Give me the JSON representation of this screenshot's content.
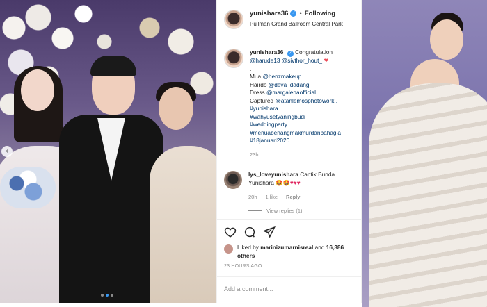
{
  "post": {
    "username": "yunishara36",
    "follow_status": "Following",
    "location": "Pullman Grand Ballroom Central Park"
  },
  "caption": {
    "username": "yunishara36",
    "line1": "Congratulation",
    "mentions1": "@harude13 @sivthor_hout_",
    "dot": ".",
    "mua_label": "Mua",
    "mua_handle": "@henzmakeup",
    "hairdo_label": "Hairdo",
    "hairdo_handle": "@deva_dadang",
    "dress_label": "Dress",
    "dress_handle": "@margalenaofficial",
    "captured_label": "Captured",
    "captured_handle": "@atanlemosphotowork .",
    "tag1": "#yunishara",
    "tag2": "#wahyusetyaningbudi",
    "tag3": "#weddingparty",
    "tag4": "#menuabenangmakmurdanbahagia",
    "tag5": "#18januari2020",
    "time": "23h"
  },
  "comment": {
    "username": "lys_loveyunishara",
    "text": "Cantik Bunda Yunishara",
    "emoji": "🤩🤩♥♥♥",
    "time": "20h",
    "likes": "1 like",
    "reply": "Reply",
    "view_replies": "View replies (1)"
  },
  "likes": {
    "prefix": "Liked by",
    "user": "marinizumarnisreal",
    "middle": "and",
    "others": "16,386 others"
  },
  "post_time": "23 HOURS AGO",
  "add_comment_placeholder": "Add a comment...",
  "icons": [
    "heart-icon",
    "comment-icon",
    "share-icon",
    "verified-icon",
    "chevron-left-icon"
  ],
  "colors": {
    "link": "#00376b",
    "verified": "#3897f0",
    "muted": "#8e8e8e"
  }
}
